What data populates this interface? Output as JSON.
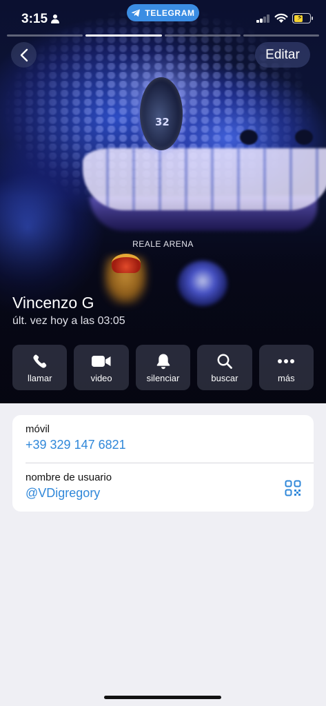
{
  "status_bar": {
    "time": "3:15",
    "app_pill": "TELEGRAM",
    "battery_level": 0.55,
    "signal_bars": 2,
    "colors": {
      "pill": "#3b8de3",
      "battery": "#f7d330"
    }
  },
  "header": {
    "edit_label": "Editar",
    "story_count": 4,
    "active_story": 2
  },
  "photo": {
    "caption": "REALE ARENA",
    "jersey_number": "32"
  },
  "profile": {
    "name": "Vincenzo G",
    "last_seen": "últ. vez hoy a las 03:05"
  },
  "actions": [
    {
      "label": "llamar",
      "icon": "phone-icon"
    },
    {
      "label": "video",
      "icon": "video-camera-icon"
    },
    {
      "label": "silenciar",
      "icon": "bell-icon"
    },
    {
      "label": "buscar",
      "icon": "search-icon"
    },
    {
      "label": "más",
      "icon": "more-dots-icon"
    }
  ],
  "info": {
    "phone_label": "móvil",
    "phone_value": "+39 329 147 6821",
    "username_label": "nombre de usuario",
    "username_value": "@VDigregory",
    "link_color": "#2f87d9"
  }
}
